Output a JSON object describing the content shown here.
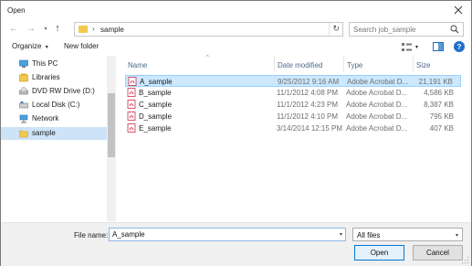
{
  "window": {
    "title": "Open"
  },
  "address": {
    "path": "sample",
    "separator": "›"
  },
  "search": {
    "placeholder": "Search job_sample"
  },
  "toolbar": {
    "organize_label": "Organize",
    "organize_caret": "▾",
    "new_folder_label": "New folder",
    "view_caret": "▾",
    "help_glyph": "?"
  },
  "nav": {
    "items": [
      {
        "label": "This PC",
        "icon": "pc-icon"
      },
      {
        "label": "Libraries",
        "icon": "libraries-icon"
      },
      {
        "label": "DVD RW Drive (D:)",
        "icon": "dvd-drive-icon"
      },
      {
        "label": "Local Disk (C:)",
        "icon": "disk-icon"
      },
      {
        "label": "Network",
        "icon": "network-icon"
      },
      {
        "label": "sample",
        "icon": "folder-icon",
        "selected": true
      }
    ]
  },
  "files": {
    "columns": {
      "name": "Name",
      "date": "Date modified",
      "type": "Type",
      "size": "Size",
      "sort_glyph": "^"
    },
    "rows": [
      {
        "name": "A_sample",
        "date": "9/25/2012 9:16 AM",
        "type": "Adobe Acrobat D...",
        "size": "21,191 KB",
        "selected": true
      },
      {
        "name": "B_sample",
        "date": "11/1/2012 4:08 PM",
        "type": "Adobe Acrobat D...",
        "size": "4,586 KB"
      },
      {
        "name": "C_sample",
        "date": "11/1/2012 4:23 PM",
        "type": "Adobe Acrobat D...",
        "size": "8,387 KB"
      },
      {
        "name": "D_sample",
        "date": "11/1/2012 4:10 PM",
        "type": "Adobe Acrobat D...",
        "size": "795 KB"
      },
      {
        "name": "E_sample",
        "date": "3/14/2014 12:15 PM",
        "type": "Adobe Acrobat D...",
        "size": "407 KB"
      }
    ]
  },
  "footer": {
    "filename_label": "File name:",
    "filename_value": "A_sample",
    "filter_value": "All files",
    "dropdown_glyph": "▾",
    "open_label": "Open",
    "cancel_label": "Cancel"
  },
  "colors": {
    "selection": "#cce8ff",
    "accent": "#0078d7",
    "folder": "#f2c94c",
    "pdf": "#c8102e"
  }
}
